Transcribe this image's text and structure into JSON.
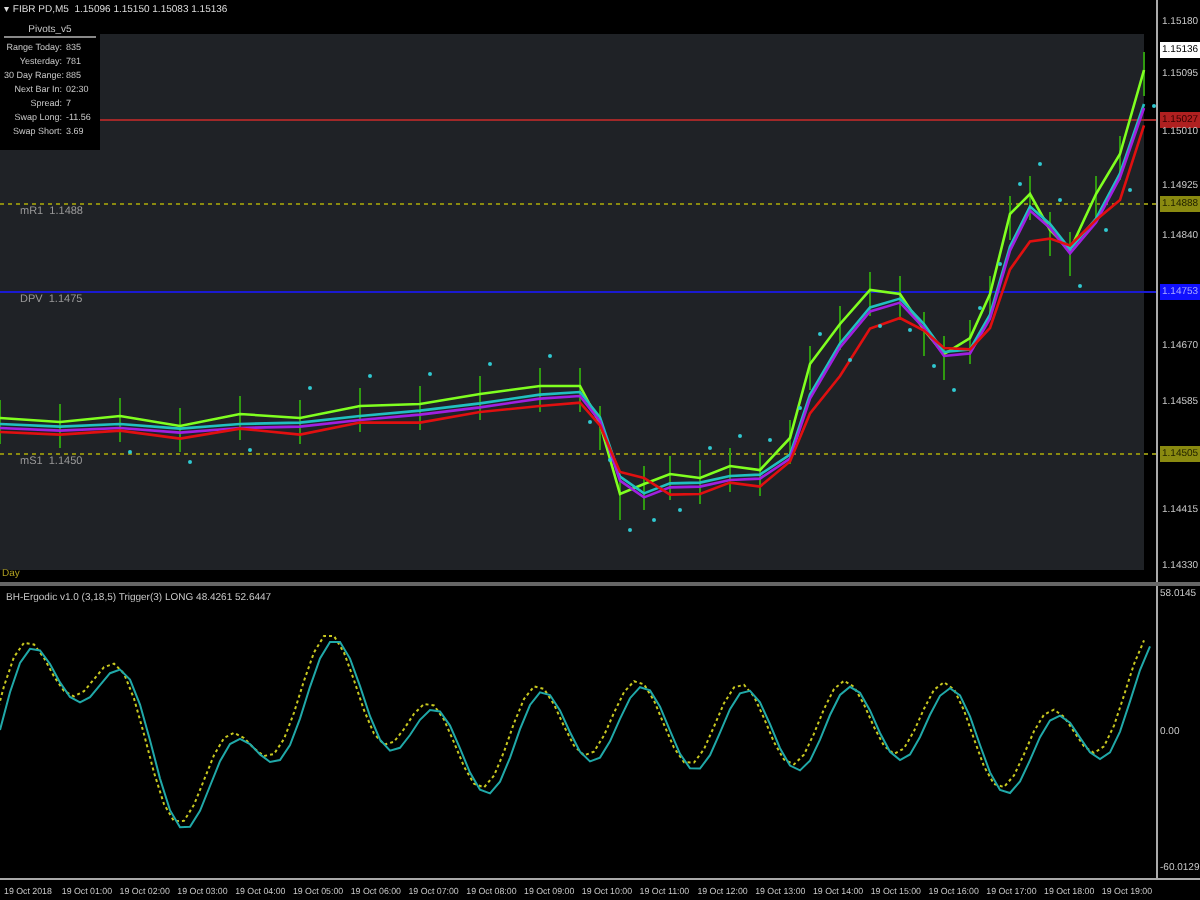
{
  "header": {
    "glyph": "▾",
    "symbol": "FIBR PD,M5",
    "quotes": "1.15096 1.15150 1.15083 1.15136"
  },
  "pivot_panel": {
    "title": "Pivots_v5",
    "rows": [
      {
        "label": "Range  Today:",
        "value": "835"
      },
      {
        "label": "Yesterday:",
        "value": "781"
      },
      {
        "label": "30 Day Range:",
        "value": "885"
      },
      {
        "label": "Next Bar In:",
        "value": "02:30"
      },
      {
        "label": "Spread:",
        "value": "7"
      },
      {
        "label": "Swap  Long:",
        "value": "-11.56"
      },
      {
        "label": "Swap  Short:",
        "value": "3.69"
      }
    ]
  },
  "levels": [
    {
      "kind": "red"
    },
    {
      "kind": "yellow",
      "label": "mR1  1.1488"
    },
    {
      "kind": "blue",
      "label": "DPV  1.1475"
    },
    {
      "kind": "yellow",
      "label": "mS1  1.1450"
    }
  ],
  "period_label": "Day",
  "price_axis": [
    {
      "text": "1.15180",
      "kind": "plain"
    },
    {
      "text": "1.15136",
      "kind": "white"
    },
    {
      "text": "1.15095",
      "kind": "plain"
    },
    {
      "text": "1.15027",
      "kind": "red"
    },
    {
      "text": "1.15010",
      "kind": "plain"
    },
    {
      "text": "1.14925",
      "kind": "plain"
    },
    {
      "text": "1.14888",
      "kind": "yellow"
    },
    {
      "text": "1.14840",
      "kind": "plain"
    },
    {
      "text": "1.14753",
      "kind": "blue"
    },
    {
      "text": "1.14670",
      "kind": "plain"
    },
    {
      "text": "1.14585",
      "kind": "plain"
    },
    {
      "text": "1.14505",
      "kind": "yellow"
    },
    {
      "text": "1.14415",
      "kind": "plain"
    },
    {
      "text": "1.14330",
      "kind": "plain"
    }
  ],
  "indicator": {
    "title": "BH-Ergodic v1.0 (3,18,5) Trigger(3) LONG 48.4261 52.6447",
    "axis": [
      "58.0145",
      "0.00",
      "-60.0129"
    ]
  },
  "time_axis": [
    "19 Oct 2018",
    "19 Oct 01:00",
    "19 Oct 02:00",
    "19 Oct 03:00",
    "19 Oct 04:00",
    "19 Oct 05:00",
    "19 Oct 06:00",
    "19 Oct 07:00",
    "19 Oct 08:00",
    "19 Oct 09:00",
    "19 Oct 10:00",
    "19 Oct 11:00",
    "19 Oct 12:00",
    "19 Oct 13:00",
    "19 Oct 14:00",
    "19 Oct 15:00",
    "19 Oct 16:00",
    "19 Oct 17:00",
    "19 Oct 18:00",
    "19 Oct 19:00"
  ]
}
